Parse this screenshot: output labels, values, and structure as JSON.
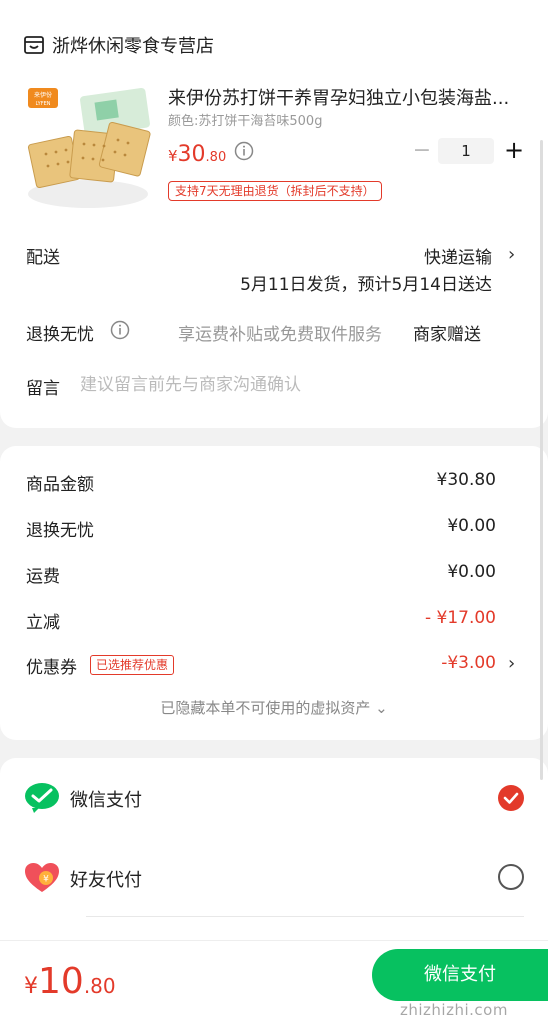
{
  "store": {
    "name": "浙烨休闲零食专营店",
    "icon": "store-icon"
  },
  "product": {
    "title": "来伊份苏打饼干养胃孕妇独立小包装海盐...",
    "variant": "颜色:苏打饼干海苔味500g",
    "price_currency": "¥",
    "price_int": "30",
    "price_dec": ".80",
    "quantity": "1",
    "minus_symbol": "−",
    "plus_symbol": "+",
    "return_tag": "支持7天无理由退货（拆封后不支持）",
    "image_brand": "来伊份",
    "image_brand_en": "LYFEN"
  },
  "delivery": {
    "label": "配送",
    "method": "快递运输",
    "time": "5月11日发货，预计5月14日送达"
  },
  "return_service": {
    "label": "退换无忧",
    "desc": "享运费补贴或免费取件服务",
    "gift": "商家赠送"
  },
  "message": {
    "label": "留言",
    "placeholder": "建议留言前先与商家沟通确认"
  },
  "summary": {
    "goods_label": "商品金额",
    "goods_value": "¥30.80",
    "return_label": "退换无忧",
    "return_value": "¥0.00",
    "shipping_label": "运费",
    "shipping_value": "¥0.00",
    "discount_label": "立减",
    "discount_value": "- ¥17.00",
    "coupon_label": "优惠券",
    "coupon_tag": "已选推荐优惠",
    "coupon_value": "-¥3.00",
    "hidden_note": "已隐藏本单不可使用的虚拟资产 ⌄"
  },
  "payment": {
    "wechat_label": "微信支付",
    "friend_label": "好友代付",
    "selected": "wechat"
  },
  "footer": {
    "total_currency": "¥",
    "total_int": "10",
    "total_dec": ".80",
    "pay_button": "微信支付",
    "watermark": "zhizhizhi.com"
  },
  "colors": {
    "accent": "#e33a2a",
    "wechat": "#07c160",
    "friend": "#f0505a"
  }
}
